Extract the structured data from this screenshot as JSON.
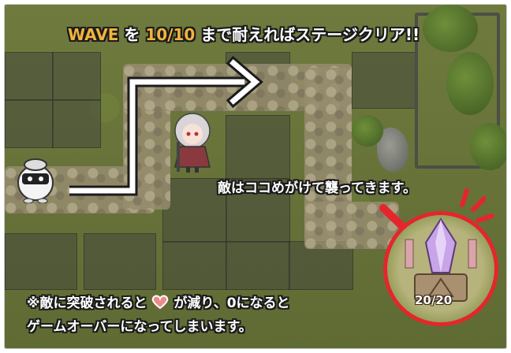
{
  "banner": {
    "wave_label": "WAVE",
    "particle_wo": "を",
    "wave_count": "10/10",
    "suffix": "まで耐えればステージクリア!!"
  },
  "enemy_notice": "敵はココめがけて襲ってきます。",
  "bottom_note": {
    "line1_pre": "※敵に突破されると",
    "line1_post": "が減り、0になると",
    "line2": "ゲームオーバーになってしまいます。"
  },
  "crystal_counter": "20/20",
  "icons": {
    "heart": "heart-life-icon",
    "crystal": "crystal-core-icon",
    "path_arrow": "path-arrow",
    "pointer_arrow": "pointer-arrow"
  },
  "colors": {
    "highlight": "#f2b33d",
    "circle_ring": "#e4262c",
    "heart": "#f08a8a"
  }
}
